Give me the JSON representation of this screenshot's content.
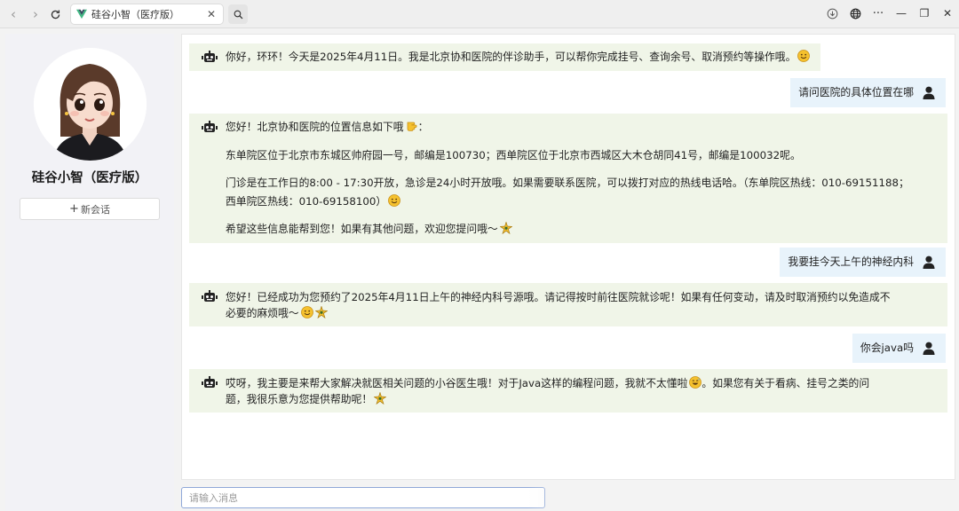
{
  "browser": {
    "tab_title": "硅谷小智（医疗版）",
    "tab_close": "✕",
    "nav_back": "‹",
    "nav_forward": "›",
    "icons": [
      "reload-icon",
      "search-icon",
      "download-icon",
      "globe-icon",
      "more-icon",
      "minimize-icon",
      "restore-icon",
      "close-icon"
    ],
    "more_label": "···",
    "minimize_label": "—",
    "restore_label": "❐",
    "close_label": "✕"
  },
  "sidebar": {
    "app_name": "硅谷小智（医疗版）",
    "new_chat_plus": "+",
    "new_chat_label": "新会话"
  },
  "messages": [
    {
      "role": "assistant",
      "paragraphs": [
        "你好，环环！今天是2025年4月11日。我是北京协和医院的伴诊助手，可以帮你完成挂号、查询余号、取消预约等操作哦。"
      ],
      "emoji": [
        "smile"
      ]
    },
    {
      "role": "user",
      "text": "请问医院的具体位置在哪"
    },
    {
      "role": "assistant",
      "paragraphs": [
        "您好！北京协和医院的位置信息如下哦",
        "东单院区位于北京市东城区帅府园一号，邮编是100730；西单院区位于北京市西城区大木仓胡同41号，邮编是100032呢。",
        "门诊是在工作日的8:00 - 17:30开放，急诊是24小时开放哦。如果需要联系医院，可以拨打对应的热线电话哈。（东单院区热线：010-69151188；",
        "西单院区热线：010-69158100）",
        "希望这些信息能帮到您！如果有其他问题，欢迎您提问哦～"
      ],
      "emoji": [
        "point",
        "smile",
        "sparkle"
      ]
    },
    {
      "role": "user",
      "text": "我要挂今天上午的神经内科"
    },
    {
      "role": "assistant",
      "paragraphs": [
        "您好！已经成功为您预约了2025年4月11日上午的神经内科号源哦。请记得按时前往医院就诊呢！如果有任何变动，请及时取消预约以免造成不",
        "必要的麻烦哦～"
      ],
      "emoji": [
        "smile",
        "sparkle"
      ]
    },
    {
      "role": "user",
      "text": "你会java吗"
    },
    {
      "role": "assistant",
      "paragraphs": [
        "哎呀，我主要是来帮大家解决就医相关问题的小谷医生哦！对于Java这样的编程问题，我就不太懂啦",
        "。如果您有关于看病、挂号之类的问",
        "题，我很乐意为您提供帮助呢！"
      ],
      "emoji": [
        "grin",
        "sparkle"
      ]
    }
  ],
  "input": {
    "placeholder": "请输入消息",
    "value": ""
  },
  "colors": {
    "bot_bubble": "#f0f5e8",
    "user_bubble": "#e8f3fb",
    "sidebar_bg": "#f2f2f6",
    "input_border": "#8fa8d8",
    "vue_green": "#41b883",
    "vue_dark": "#35495e"
  }
}
